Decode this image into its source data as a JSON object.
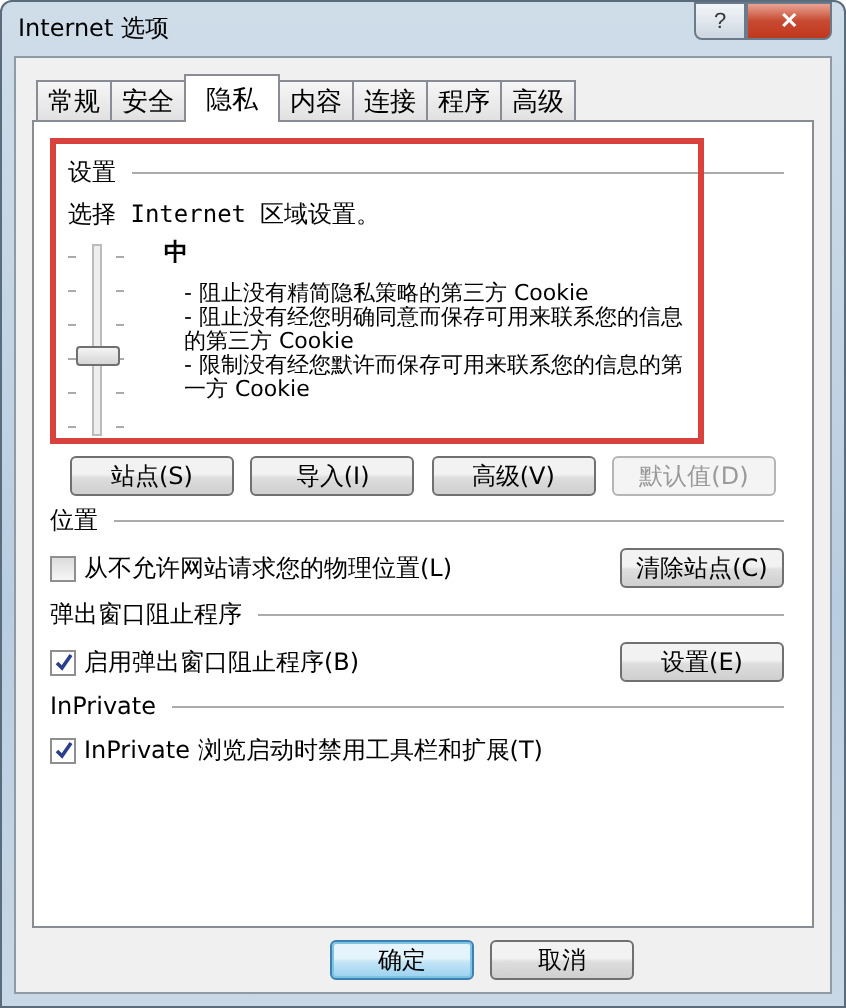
{
  "window": {
    "title": "Internet 选项",
    "help_button": "?",
    "close_button": "✕"
  },
  "tabs": [
    {
      "label": "常规",
      "selected": false
    },
    {
      "label": "安全",
      "selected": false
    },
    {
      "label": "隐私",
      "selected": true
    },
    {
      "label": "内容",
      "selected": false
    },
    {
      "label": "连接",
      "selected": false
    },
    {
      "label": "程序",
      "selected": false
    },
    {
      "label": "高级",
      "selected": false
    }
  ],
  "settings": {
    "heading": "设置",
    "instruction": "选择 Internet 区域设置。",
    "slider": {
      "level": 0.4
    },
    "level_name": "中",
    "description": [
      "- 阻止没有精简隐私策略的第三方 Cookie",
      "- 阻止没有经您明确同意而保存可用来联系您的信息的第三方 Cookie",
      "- 限制没有经您默许而保存可用来联系您的信息的第一方 Cookie"
    ],
    "buttons": [
      {
        "label": "站点(S)",
        "disabled": false
      },
      {
        "label": "导入(I)",
        "disabled": false
      },
      {
        "label": "高级(V)",
        "disabled": false
      },
      {
        "label": "默认值(D)",
        "disabled": true
      }
    ]
  },
  "location": {
    "heading": "位置",
    "checkbox": {
      "label": "从不允许网站请求您的物理位置(L)",
      "checked": false
    },
    "button": "清除站点(C)"
  },
  "popup_blocker": {
    "heading": "弹出窗口阻止程序",
    "checkbox": {
      "label": "启用弹出窗口阻止程序(B)",
      "checked": true
    },
    "button": "设置(E)"
  },
  "inprivate": {
    "heading": "InPrivate",
    "checkbox": {
      "label": "InPrivate 浏览启动时禁用工具栏和扩展(T)",
      "checked": true
    }
  },
  "footer_buttons": [
    {
      "label": "确定",
      "default": true
    },
    {
      "label": "取消",
      "default": false
    }
  ]
}
